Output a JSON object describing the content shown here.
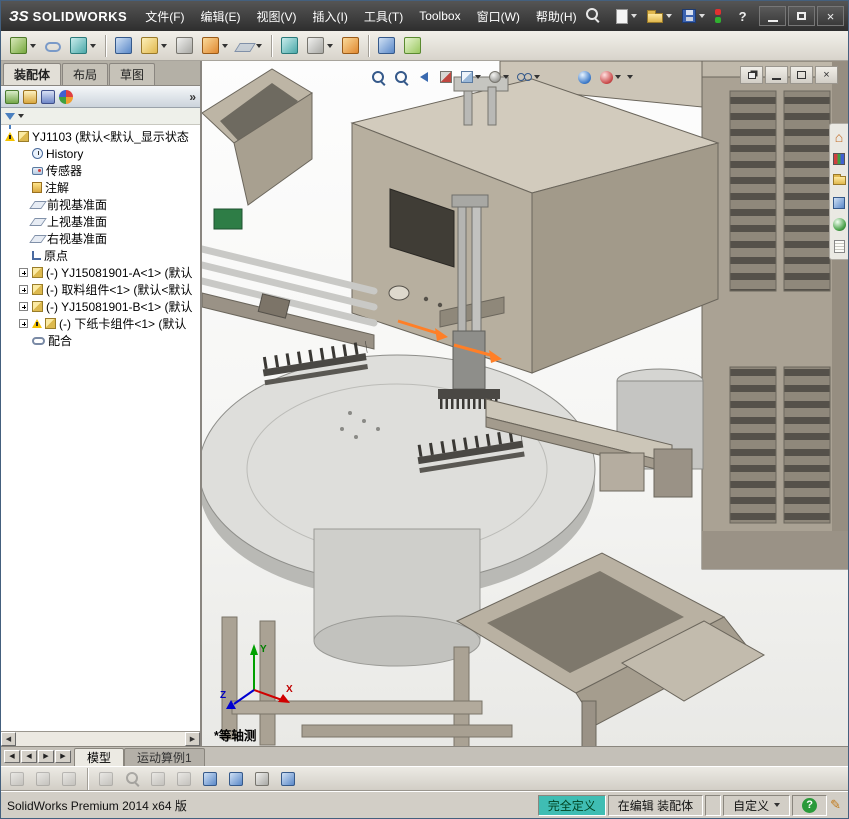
{
  "colors": {
    "titlebar_bg": "#383838",
    "toolbar_bg": "#d6d2ca",
    "status_fully_defined_bg": "#3fbdb3",
    "selection_orange": "#ff7f27",
    "machine_tan": "#b4ac9d",
    "table_gray": "#dededb"
  },
  "icons": {
    "dropdown": "▾",
    "overflow": "»",
    "close": "×",
    "nav_prev": "◀",
    "nav_next": "▶",
    "scroll_left": "◀",
    "scroll_right": "▶",
    "home": "⌂",
    "pencil": "✎",
    "help": "?"
  },
  "titlebar": {
    "logo_mark": "ЗS",
    "logo_text": "SOLIDWORKS",
    "help_glyph": "?"
  },
  "menu": {
    "items": [
      {
        "label": "文件(F)"
      },
      {
        "label": "编辑(E)"
      },
      {
        "label": "视图(V)"
      },
      {
        "label": "插入(I)"
      },
      {
        "label": "工具(T)"
      },
      {
        "label": "Toolbox"
      },
      {
        "label": "窗口(W)"
      },
      {
        "label": "帮助(H)"
      }
    ]
  },
  "command_tabs": {
    "items": [
      {
        "label": "装配体"
      },
      {
        "label": "布局"
      },
      {
        "label": "草图"
      }
    ]
  },
  "feature_tree": {
    "items": [
      {
        "label": "YJ1103 (默认<默认_显示状态"
      },
      {
        "label": "History"
      },
      {
        "label": "传感器"
      },
      {
        "label": "注解"
      },
      {
        "label": "前视基准面"
      },
      {
        "label": "上视基准面"
      },
      {
        "label": "右视基准面"
      },
      {
        "label": "原点"
      },
      {
        "label": "(-) YJ15081901-A<1> (默认"
      },
      {
        "label": "(-) 取料组件<1> (默认<默认"
      },
      {
        "label": "(-) YJ15081901-B<1> (默认"
      },
      {
        "label": "(-) 下纸卡组件<1> (默认"
      },
      {
        "label": "配合"
      }
    ]
  },
  "viewport": {
    "view_label": "*等轴测",
    "triad": {
      "x": "X",
      "y": "Y",
      "z": "Z"
    }
  },
  "doc_tabs": {
    "items": [
      {
        "label": "模型"
      },
      {
        "label": "运动算例1"
      }
    ]
  },
  "statusbar": {
    "left_text": "SolidWorks Premium 2014 x64 版",
    "fully_defined": "完全定义",
    "editing": "在编辑 装配体",
    "custom": "自定义"
  }
}
